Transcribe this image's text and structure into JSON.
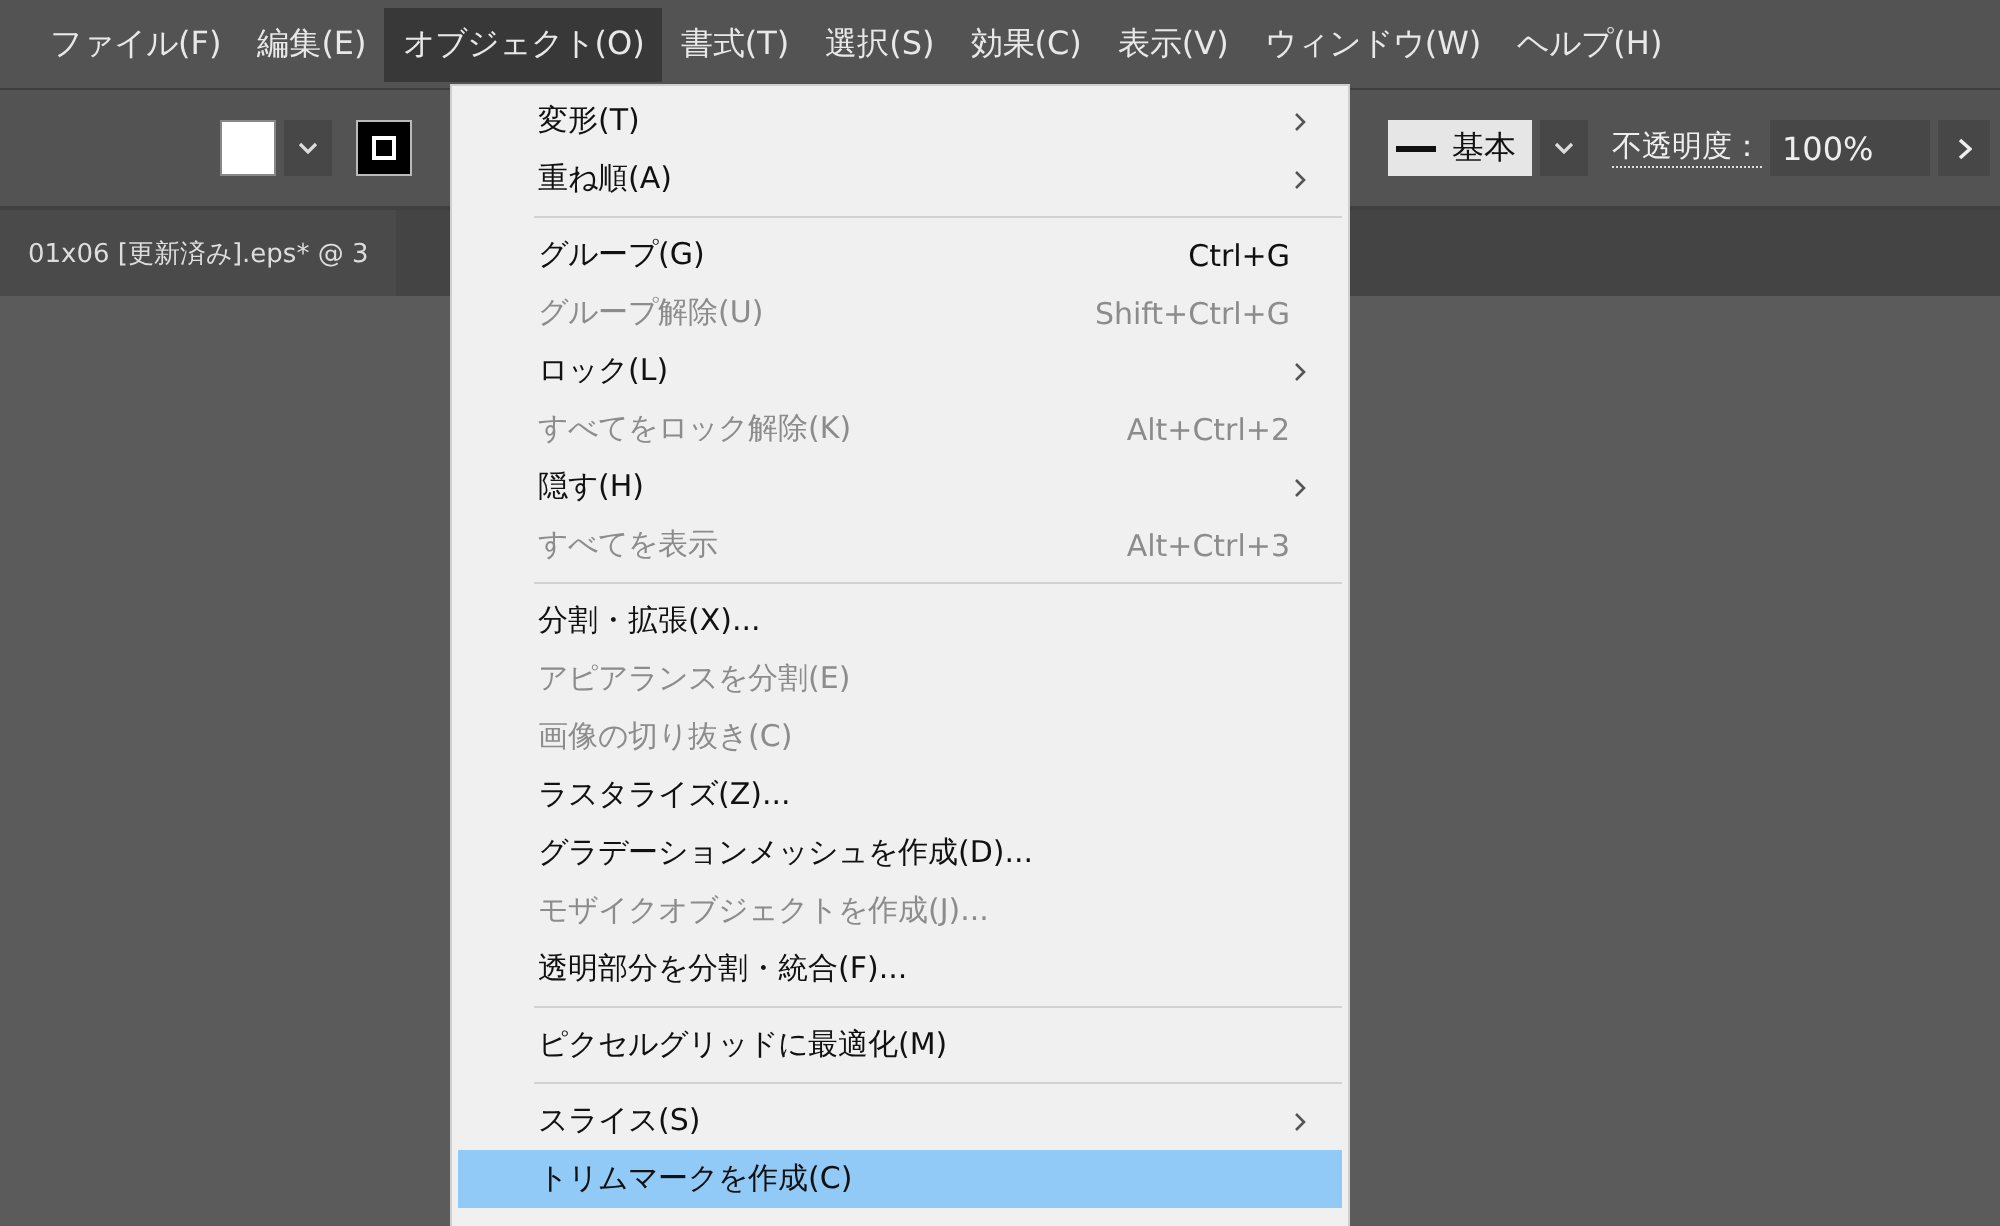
{
  "menubar": [
    {
      "label": "ファイル(F)",
      "selected": false
    },
    {
      "label": "編集(E)",
      "selected": false
    },
    {
      "label": "オブジェクト(O)",
      "selected": true
    },
    {
      "label": "書式(T)",
      "selected": false
    },
    {
      "label": "選択(S)",
      "selected": false
    },
    {
      "label": "効果(C)",
      "selected": false
    },
    {
      "label": "表示(V)",
      "selected": false
    },
    {
      "label": "ウィンドウ(W)",
      "selected": false
    },
    {
      "label": "ヘルプ(H)",
      "selected": false
    }
  ],
  "control_bar": {
    "stroke_style": "基本",
    "opacity_label": "不透明度：",
    "opacity_value": "100%"
  },
  "document_tab": {
    "title": "01x06 [更新済み].eps* @ 3"
  },
  "object_menu": [
    {
      "kind": "item",
      "label": "変形(T)",
      "submenu": true,
      "disabled": false,
      "selected": false
    },
    {
      "kind": "item",
      "label": "重ね順(A)",
      "submenu": true,
      "disabled": false,
      "selected": false
    },
    {
      "kind": "separator"
    },
    {
      "kind": "item",
      "label": "グループ(G)",
      "shortcut": "Ctrl+G",
      "submenu": false,
      "disabled": false,
      "selected": false
    },
    {
      "kind": "item",
      "label": "グループ解除(U)",
      "shortcut": "Shift+Ctrl+G",
      "submenu": false,
      "disabled": true,
      "selected": false
    },
    {
      "kind": "item",
      "label": "ロック(L)",
      "submenu": true,
      "disabled": false,
      "selected": false
    },
    {
      "kind": "item",
      "label": "すべてをロック解除(K)",
      "shortcut": "Alt+Ctrl+2",
      "submenu": false,
      "disabled": true,
      "selected": false
    },
    {
      "kind": "item",
      "label": "隠す(H)",
      "submenu": true,
      "disabled": false,
      "selected": false
    },
    {
      "kind": "item",
      "label": "すべてを表示",
      "shortcut": "Alt+Ctrl+3",
      "submenu": false,
      "disabled": true,
      "selected": false
    },
    {
      "kind": "separator"
    },
    {
      "kind": "item",
      "label": "分割・拡張(X)...",
      "submenu": false,
      "disabled": false,
      "selected": false
    },
    {
      "kind": "item",
      "label": "アピアランスを分割(E)",
      "submenu": false,
      "disabled": true,
      "selected": false
    },
    {
      "kind": "item",
      "label": "画像の切り抜き(C)",
      "submenu": false,
      "disabled": true,
      "selected": false
    },
    {
      "kind": "item",
      "label": "ラスタライズ(Z)...",
      "submenu": false,
      "disabled": false,
      "selected": false
    },
    {
      "kind": "item",
      "label": "グラデーションメッシュを作成(D)...",
      "submenu": false,
      "disabled": false,
      "selected": false
    },
    {
      "kind": "item",
      "label": "モザイクオブジェクトを作成(J)...",
      "submenu": false,
      "disabled": true,
      "selected": false
    },
    {
      "kind": "item",
      "label": "透明部分を分割・統合(F)...",
      "submenu": false,
      "disabled": false,
      "selected": false
    },
    {
      "kind": "separator"
    },
    {
      "kind": "item",
      "label": "ピクセルグリッドに最適化(M)",
      "submenu": false,
      "disabled": false,
      "selected": false
    },
    {
      "kind": "separator"
    },
    {
      "kind": "item",
      "label": "スライス(S)",
      "submenu": true,
      "disabled": false,
      "selected": false
    },
    {
      "kind": "item",
      "label": "トリムマークを作成(C)",
      "submenu": false,
      "disabled": false,
      "selected": true
    }
  ]
}
